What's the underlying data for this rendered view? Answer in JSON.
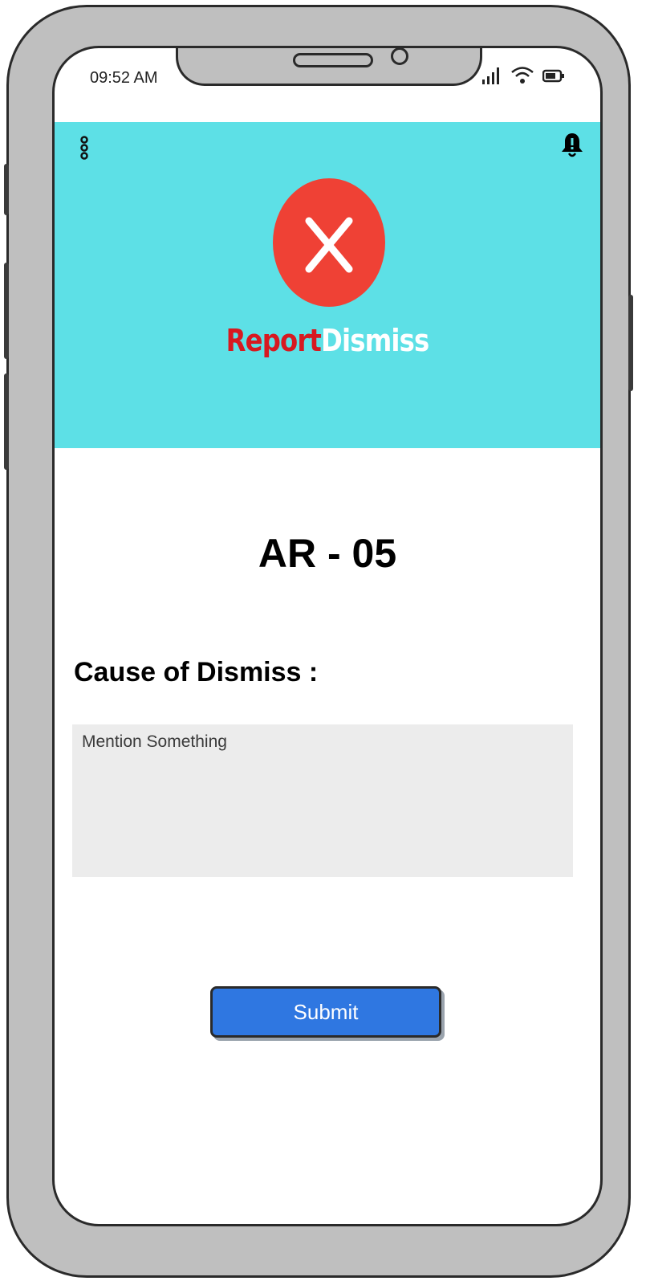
{
  "status_bar": {
    "time": "09:52 AM",
    "icons": [
      "signal-icon",
      "wifi-icon",
      "battery-icon"
    ]
  },
  "header": {
    "background_color": "#5de0e6",
    "menu_icon": "more-vertical-icon",
    "notification_icon": "bell-alert-icon",
    "logo": {
      "icon": "close-x-icon",
      "circle_color": "#ef4135",
      "brand_part1": "Report",
      "brand_part2": "Dismiss",
      "brand_part1_color": "#d71920",
      "brand_part2_color": "#ffffff"
    }
  },
  "main": {
    "report_id": "AR - 05",
    "cause_label": "Cause of Dismiss :",
    "cause_placeholder": "Mention Something",
    "cause_value": "",
    "submit_label": "Submit",
    "submit_color": "#2f77e1"
  }
}
